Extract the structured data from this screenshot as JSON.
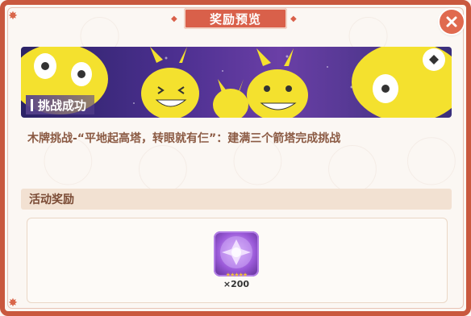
{
  "dialog": {
    "title": "奖励预览"
  },
  "hero": {
    "tag": "挑战成功"
  },
  "challenge": {
    "description": "木牌挑战-“平地起高塔，转眼就有仨”：建满三个箭塔完成挑战"
  },
  "rewards": {
    "section_title": "活动奖励",
    "items": [
      {
        "icon": "purple-crystal-orb-icon",
        "count": "×200"
      }
    ]
  },
  "colors": {
    "frame": "#c9583e",
    "banner": "#d9604a",
    "text_brown": "#8b5a43",
    "hero_bg": "#4b2f8f",
    "mascot_yellow": "#f4e12e"
  }
}
